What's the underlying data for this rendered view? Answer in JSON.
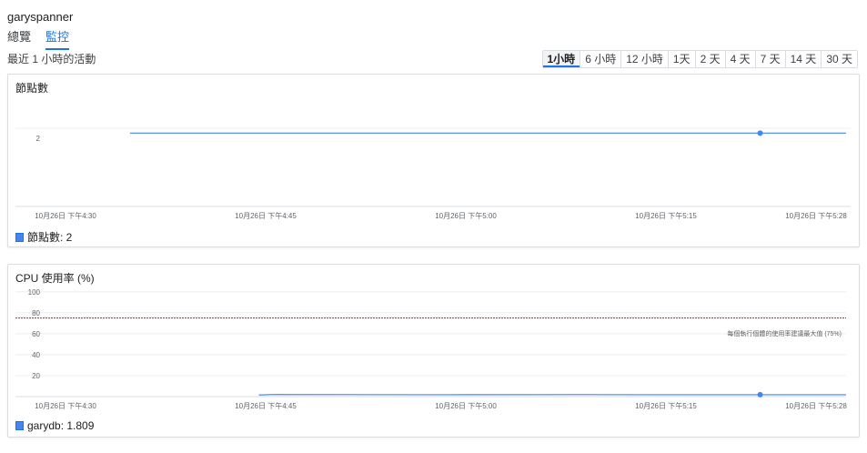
{
  "instance": {
    "name": "garyspanner"
  },
  "tabs": [
    {
      "label": "總覽",
      "active": false
    },
    {
      "label": "監控",
      "active": true
    }
  ],
  "activity_label": "最近 1 小時的活動",
  "time_ranges": [
    {
      "label": "1小時",
      "active": true
    },
    {
      "label": "6 小時",
      "active": false
    },
    {
      "label": "12 小時",
      "active": false
    },
    {
      "label": "1天",
      "active": false
    },
    {
      "label": "2 天",
      "active": false
    },
    {
      "label": "4 天",
      "active": false
    },
    {
      "label": "7 天",
      "active": false
    },
    {
      "label": "14 天",
      "active": false
    },
    {
      "label": "30 天",
      "active": false
    }
  ],
  "colors": {
    "accent": "#1a73e8",
    "series": "#4285f4",
    "threshold": "#d93025"
  },
  "charts": {
    "nodes": {
      "title": "節點數",
      "legend": "節點數: 2",
      "x_ticks": [
        "10月26日 下午4:30",
        "10月26日 下午4:45",
        "10月26日 下午5:00",
        "10月26日 下午5:15",
        "10月26日 下午5:28"
      ],
      "y_ticks": [
        "2"
      ]
    },
    "cpu": {
      "title": "CPU 使用率 (%)",
      "legend": "garydb: 1.809",
      "x_ticks": [
        "10月26日 下午4:30",
        "10月26日 下午4:45",
        "10月26日 下午5:00",
        "10月26日 下午5:15",
        "10月26日 下午5:28"
      ],
      "y_ticks": [
        "100",
        "80",
        "60",
        "40",
        "20"
      ],
      "threshold_label": "每個執行個體的使用率建議最大值 (75%)"
    }
  },
  "chart_data": [
    {
      "type": "line",
      "title": "節點數",
      "x": [
        "16:38",
        "17:00",
        "17:15",
        "17:22",
        "17:28"
      ],
      "series": [
        {
          "name": "節點數",
          "values": [
            2,
            2,
            2,
            2,
            2
          ]
        }
      ],
      "ylim": [
        0,
        3
      ],
      "xlim": [
        "16:30",
        "17:28"
      ]
    },
    {
      "type": "line",
      "title": "CPU 使用率 (%)",
      "x": [
        "16:47",
        "16:48",
        "17:00",
        "17:10",
        "17:15",
        "17:22",
        "17:28"
      ],
      "series": [
        {
          "name": "garydb",
          "values": [
            1.5,
            2.0,
            1.8,
            1.9,
            1.8,
            1.809,
            1.8
          ]
        }
      ],
      "threshold": 75,
      "ylim": [
        0,
        105
      ],
      "xlim": [
        "16:30",
        "17:28"
      ]
    }
  ]
}
